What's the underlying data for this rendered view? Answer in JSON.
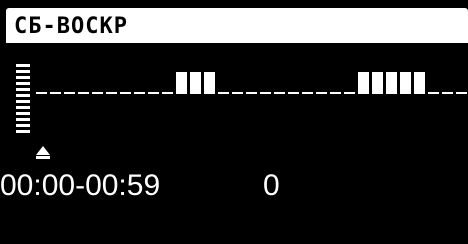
{
  "screen": {
    "title": "СБ-ВОСКР",
    "time_range": "00:00-00:59",
    "value": "0"
  },
  "schedule": {
    "slots": [
      0,
      0,
      0,
      0,
      0,
      0,
      0,
      0,
      0,
      0,
      1,
      1,
      1,
      0,
      0,
      0,
      0,
      0,
      0,
      0,
      0,
      0,
      0,
      1,
      1,
      1,
      1,
      1,
      0,
      0,
      0,
      0
    ],
    "cursor_slot": 0
  },
  "colors": {
    "background": "#000000",
    "foreground": "#ffffff"
  }
}
